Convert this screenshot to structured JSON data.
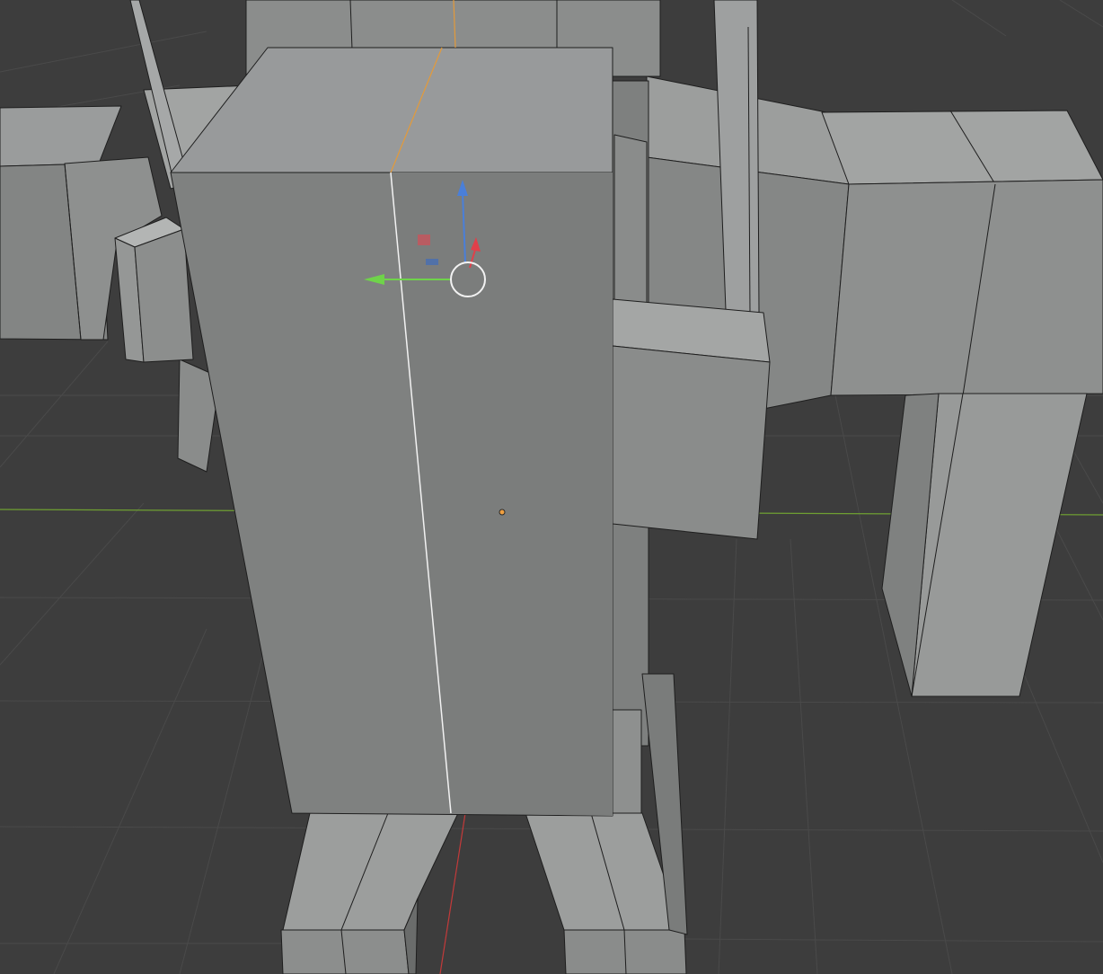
{
  "viewport": {
    "background_color": "#3d3d3d",
    "grid_color": "#4a4a4a",
    "axis_colors": {
      "x_axis": "#c33a3a",
      "y_axis": "#6fa032",
      "z_axis": "#4a7fd9"
    },
    "mesh_colors": {
      "face_light": "#989a9b",
      "face_mid": "#838584",
      "face_dark": "#6e706f",
      "edge": "#1e1e1e",
      "selected_edge": "#f2f2f2",
      "active_edge_orange": "#e39a3a",
      "origin_point": "#f0a040"
    }
  },
  "gizmo": {
    "icon": "transform-gizmo-icon",
    "axes": [
      {
        "name": "z-axis-arrow",
        "color": "#4a7fd9"
      },
      {
        "name": "y-axis-arrow",
        "color": "#6fd34a"
      },
      {
        "name": "x-axis-arrow",
        "color": "#e0404a"
      }
    ],
    "pivot": "pivot-circle-icon"
  }
}
